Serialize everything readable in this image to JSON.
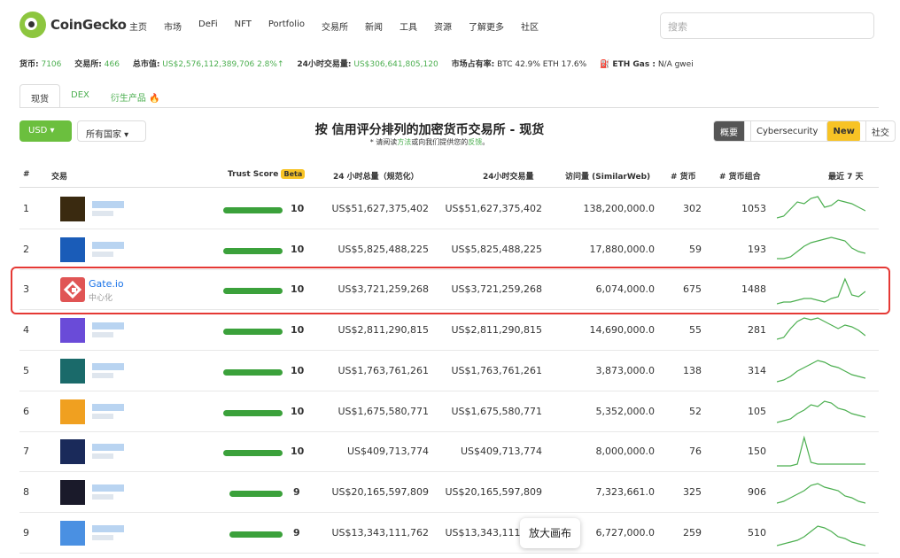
{
  "header": {
    "brand": "CoinGecko",
    "nav": [
      "主页",
      "市场",
      "DeFi",
      "NFT",
      "Portfolio",
      "交易所",
      "新闻",
      "工具",
      "资源",
      "了解更多",
      "社区"
    ],
    "search_placeholder": "搜索"
  },
  "stats": {
    "coins_label": "货币:",
    "coins_value": "7106",
    "exchanges_label": "交易所:",
    "exchanges_value": "466",
    "mcap_label": "总市值:",
    "mcap_value": "US$2,576,112,389,706",
    "mcap_change": "2.8%↑",
    "vol_label": "24小时交易量:",
    "vol_value": "US$306,641,805,120",
    "dominance_label": "市场占有率:",
    "dominance_value": "BTC 42.9%  ETH 17.6%",
    "gas_label": "⛽ ETH Gas :",
    "gas_value": "N/A gwei"
  },
  "tabs": [
    "现货",
    "DEX",
    "衍生产品 🔥"
  ],
  "controls": {
    "currency": "USD ▾",
    "country": "所有国家 ▾",
    "views": [
      "概要",
      "Cybersecurity",
      "社交"
    ],
    "new_badge": "New"
  },
  "title": "按 信用评分排列的加密货币交易所 - 现货",
  "subtitle_a": "* 请阅读",
  "subtitle_link1": "方法",
  "subtitle_b": "或向我们提供您的",
  "subtitle_link2": "反馈",
  "subtitle_c": "。",
  "columns": {
    "rank": "#",
    "exchange": "交易",
    "trust": "Trust Score",
    "beta": "Beta",
    "vol_norm": "24 小时总量（规范化）",
    "vol": "24小时交易量",
    "visits": "访问量 (SimilarWeb)",
    "coins": "# 货币",
    "pairs": "# 货币组合",
    "last7": "最近 7 天"
  },
  "rows": [
    {
      "rank": "1",
      "trust": "10",
      "trust_fill": 1.0,
      "vol_norm": "US$51,627,375,402",
      "vol": "US$51,627,375,402",
      "visits": "138,200,000.0",
      "coins": "302",
      "pairs": "1053"
    },
    {
      "rank": "2",
      "trust": "10",
      "trust_fill": 1.0,
      "vol_norm": "US$5,825,488,225",
      "vol": "US$5,825,488,225",
      "visits": "17,880,000.0",
      "coins": "59",
      "pairs": "193"
    },
    {
      "rank": "3",
      "name": "Gate.io",
      "sub": "中心化",
      "trust": "10",
      "trust_fill": 1.0,
      "vol_norm": "US$3,721,259,268",
      "vol": "US$3,721,259,268",
      "visits": "6,074,000.0",
      "coins": "675",
      "pairs": "1488"
    },
    {
      "rank": "4",
      "trust": "10",
      "trust_fill": 1.0,
      "vol_norm": "US$2,811,290,815",
      "vol": "US$2,811,290,815",
      "visits": "14,690,000.0",
      "coins": "55",
      "pairs": "281"
    },
    {
      "rank": "5",
      "trust": "10",
      "trust_fill": 1.0,
      "vol_norm": "US$1,763,761,261",
      "vol": "US$1,763,761,261",
      "visits": "3,873,000.0",
      "coins": "138",
      "pairs": "314"
    },
    {
      "rank": "6",
      "trust": "10",
      "trust_fill": 1.0,
      "vol_norm": "US$1,675,580,771",
      "vol": "US$1,675,580,771",
      "visits": "5,352,000.0",
      "coins": "52",
      "pairs": "105"
    },
    {
      "rank": "7",
      "trust": "10",
      "trust_fill": 1.0,
      "vol_norm": "US$409,713,774",
      "vol": "US$409,713,774",
      "visits": "8,000,000.0",
      "coins": "76",
      "pairs": "150"
    },
    {
      "rank": "8",
      "trust": "9",
      "trust_fill": 0.9,
      "vol_norm": "US$20,165,597,809",
      "vol": "US$20,165,597,809",
      "visits": "7,323,661.0",
      "coins": "325",
      "pairs": "906"
    },
    {
      "rank": "9",
      "trust": "9",
      "trust_fill": 0.9,
      "vol_norm": "US$13,343,111,762",
      "vol": "US$13,343,111,762",
      "visits": "6,727,000.0",
      "coins": "259",
      "pairs": "510"
    }
  ],
  "tooltip": "放大画布",
  "colors": {
    "brand_green": "#8dc63f",
    "link": "#1a73e8",
    "highlight": "#e53935",
    "spark": "#4caf50"
  }
}
